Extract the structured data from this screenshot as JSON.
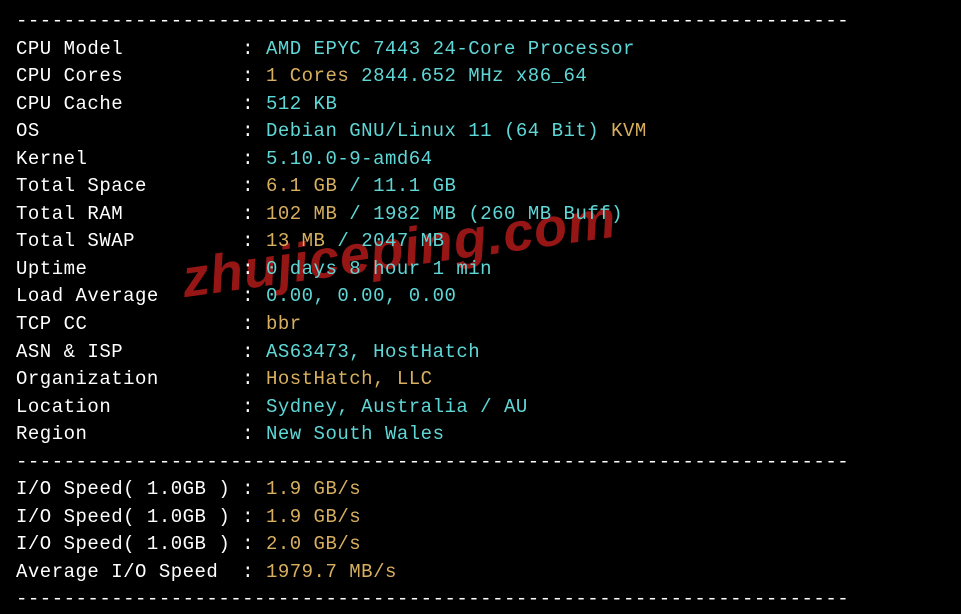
{
  "dashline": "----------------------------------------------------------------------",
  "watermark": "zhujiceping.com",
  "sysinfo": {
    "cpu_model": {
      "label": "CPU Model         ",
      "value": "AMD EPYC 7443 24-Core Processor"
    },
    "cpu_cores": {
      "label": "CPU Cores         ",
      "value1": "1 Cores",
      "value2": " 2844.652 MHz x86_64"
    },
    "cpu_cache": {
      "label": "CPU Cache         ",
      "value": "512 KB"
    },
    "os": {
      "label": "OS                ",
      "value1": "Debian GNU/Linux 11 (64 Bit)",
      "value2": " KVM"
    },
    "kernel": {
      "label": "Kernel            ",
      "value": "5.10.0-9-amd64"
    },
    "total_space": {
      "label": "Total Space       ",
      "value1": "6.1 GB",
      "sep": " / ",
      "value2": "11.1 GB"
    },
    "total_ram": {
      "label": "Total RAM         ",
      "value1": "102 MB",
      "sep": " / ",
      "value2": "1982 MB",
      "suffix": " (260 MB Buff)"
    },
    "total_swap": {
      "label": "Total SWAP        ",
      "value1": "13 MB",
      "sep": " / ",
      "value2": "2047 MB"
    },
    "uptime": {
      "label": "Uptime            ",
      "value": "0 days 8 hour 1 min"
    },
    "load_avg": {
      "label": "Load Average      ",
      "value": "0.00, 0.00, 0.00"
    },
    "tcp_cc": {
      "label": "TCP CC            ",
      "value": "bbr"
    },
    "asn_isp": {
      "label": "ASN & ISP         ",
      "value": "AS63473, HostHatch"
    },
    "organization": {
      "label": "Organization      ",
      "value": "HostHatch, LLC"
    },
    "location": {
      "label": "Location          ",
      "value": "Sydney, Australia / AU"
    },
    "region": {
      "label": "Region            ",
      "value": "New South Wales"
    }
  },
  "io": {
    "test1": {
      "label": "I/O Speed( 1.0GB )",
      "value": "1.9 GB/s"
    },
    "test2": {
      "label": "I/O Speed( 1.0GB )",
      "value": "1.9 GB/s"
    },
    "test3": {
      "label": "I/O Speed( 1.0GB )",
      "value": "2.0 GB/s"
    },
    "avg": {
      "label": "Average I/O Speed ",
      "value": "1979.7 MB/s"
    }
  },
  "colon": " : "
}
